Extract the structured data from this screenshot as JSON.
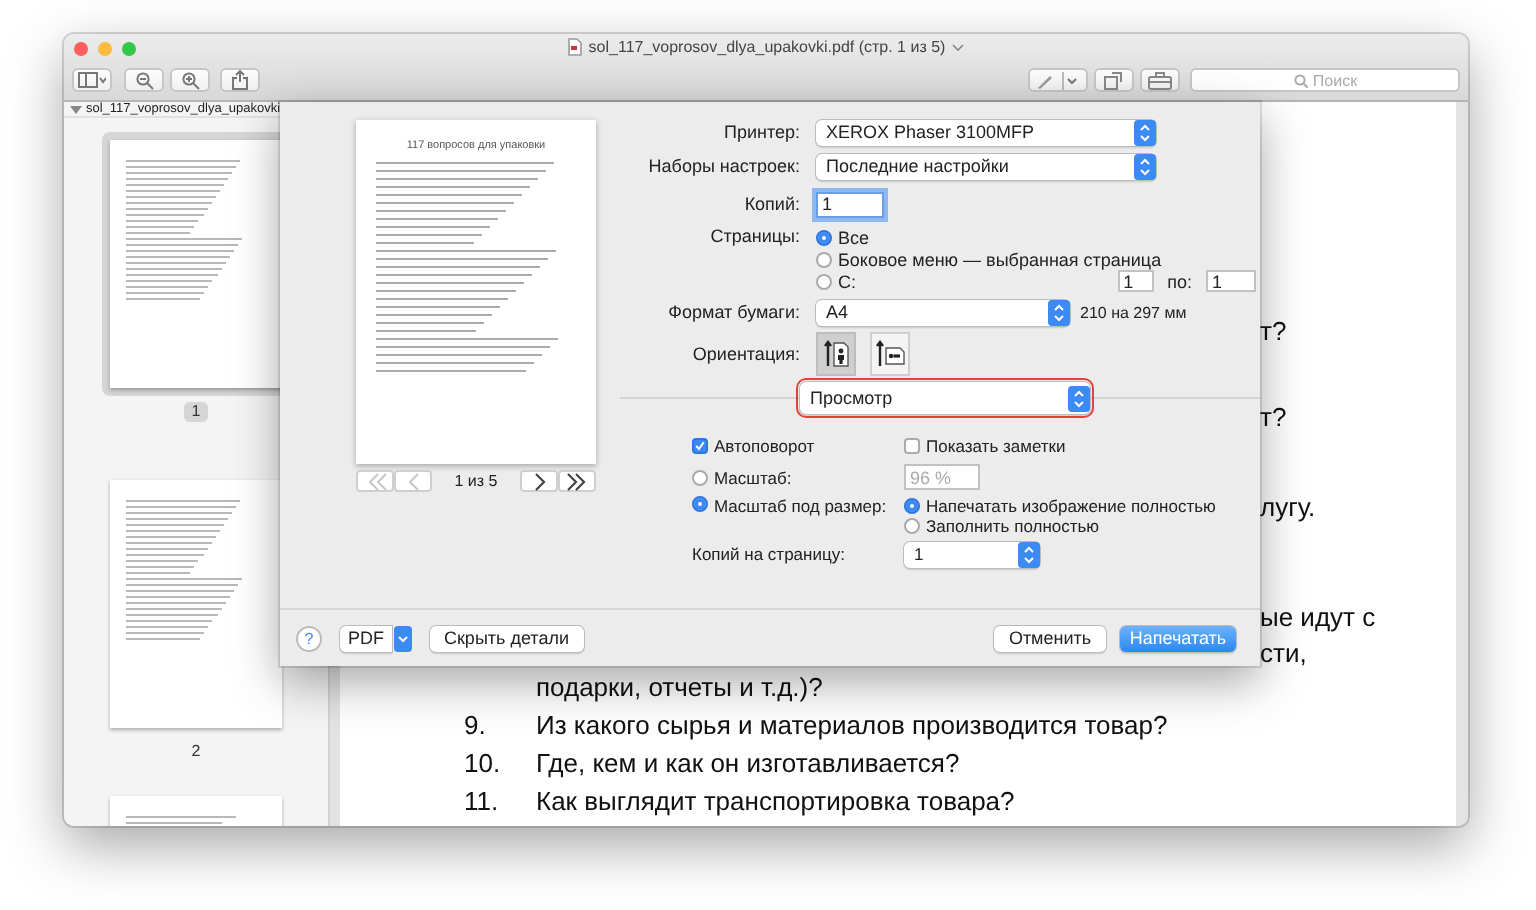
{
  "window": {
    "title": "sol_117_voprosov_dlya_upakovki.pdf (стр. 1 из 5)"
  },
  "toolbar": {
    "search": {
      "placeholder": "Поиск"
    }
  },
  "sidebar": {
    "document": "sol_117_voprosov_dlya_upakovki",
    "expanded": true,
    "pages": [
      {
        "label": "1",
        "selected": true
      },
      {
        "label": "2",
        "selected": false
      }
    ]
  },
  "document": {
    "fragments": [
      "т?",
      "т?",
      "лугу.",
      "ые идут с",
      "сти,"
    ],
    "lines": [
      {
        "text": "подарки, отчеты и т.д.)?"
      },
      {
        "number": "9.",
        "text": "Из какого сырья и материалов производится товар?"
      },
      {
        "number": "10.",
        "text": "Где, кем и как он изготавливается?"
      },
      {
        "number": "11.",
        "text": "Как выглядит транспортировка товара?"
      }
    ]
  },
  "print_dialog": {
    "preview": {
      "heading": "117 вопросов для упаковки",
      "page_indicator": "1 из 5",
      "nav": [
        {
          "kind": "first",
          "disabled": true
        },
        {
          "kind": "previous",
          "disabled": true
        },
        {
          "kind": "next",
          "disabled": false
        },
        {
          "kind": "last",
          "disabled": false
        }
      ]
    },
    "printer": {
      "label": "Принтер:",
      "value": "XEROX Phaser 3100MFP"
    },
    "presets": {
      "label": "Наборы настроек:",
      "value": "Последние настройки"
    },
    "copies": {
      "label": "Копий:",
      "value": "1"
    },
    "pages": {
      "label": "Страницы:",
      "options": [
        {
          "label": "Все",
          "selected": true
        },
        {
          "label": "Боковое меню — выбранная страница",
          "selected": false
        },
        {
          "label": "С:",
          "selected": false
        }
      ],
      "from": "1",
      "to_label": "по:",
      "to": "1"
    },
    "paper_size": {
      "label": "Формат бумаги:",
      "value": "A4",
      "dimensions": "210 на 297 мм"
    },
    "orientation": {
      "label": "Ориентация:",
      "options": [
        {
          "kind": "portrait",
          "selected": true
        },
        {
          "kind": "landscape",
          "selected": false
        }
      ]
    },
    "section_menu": {
      "value": "Просмотр",
      "highlighted": true
    },
    "auto_rotate": {
      "label": "Автоповорот",
      "checked": true
    },
    "show_notes": {
      "label": "Показать заметки",
      "checked": false
    },
    "scale": {
      "label": "Масштаб:",
      "selected": false,
      "value": "96 %",
      "disabled": true
    },
    "scale_to_fit": {
      "label": "Масштаб под размер:",
      "selected": true,
      "options": [
        {
          "label": "Напечатать изображение полностью",
          "selected": true
        },
        {
          "label": "Заполнить полностью",
          "selected": false
        }
      ]
    },
    "copies_per_page": {
      "label": "Копий на страницу:",
      "value": "1"
    },
    "help_button": "?",
    "pdf_button": "PDF",
    "hide_details_button": "Скрыть детали",
    "cancel_button": "Отменить",
    "print_button": "Напечатать"
  }
}
